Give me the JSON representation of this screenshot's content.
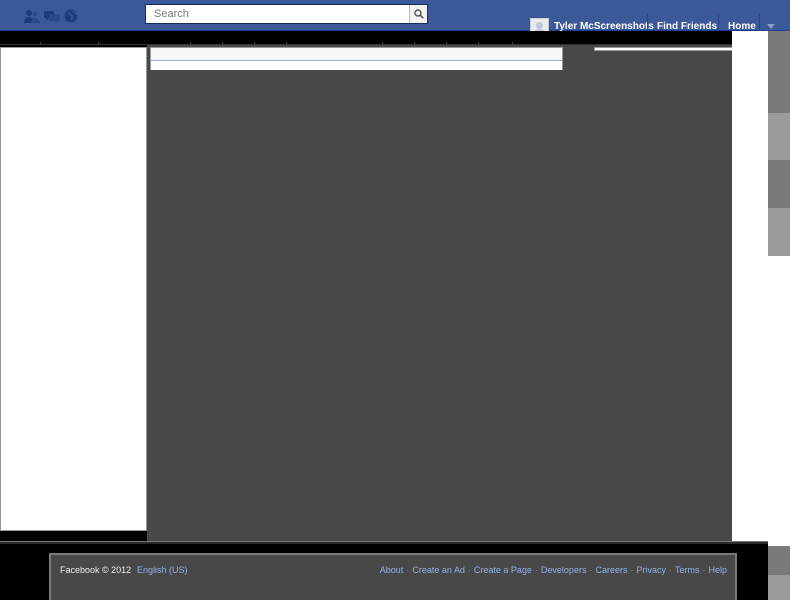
{
  "header": {
    "jewels": [
      {
        "icon": "friend-requests-icon"
      },
      {
        "icon": "messages-icon"
      },
      {
        "icon": "notifications-globe-icon"
      }
    ],
    "search": {
      "placeholder": "Search",
      "value": "",
      "button_icon": "magnifier-icon"
    },
    "user": {
      "name": "Tyler McScreenshots",
      "avatar_icon": "default-avatar-icon"
    },
    "nav": {
      "find_friends": "Find Friends",
      "home": "Home",
      "menu_icon": "triangle-down-icon"
    },
    "colors": {
      "bar": "#3b5998",
      "bar_border": "#1d4088",
      "link": "#8fb2e8"
    }
  },
  "footer": {
    "copyright": "Facebook © 2012",
    "language": "English (US)",
    "links": [
      "About",
      "Create an Ad",
      "Create a Page",
      "Developers",
      "Careers",
      "Privacy",
      "Terms",
      "Help"
    ],
    "separator": "·"
  }
}
